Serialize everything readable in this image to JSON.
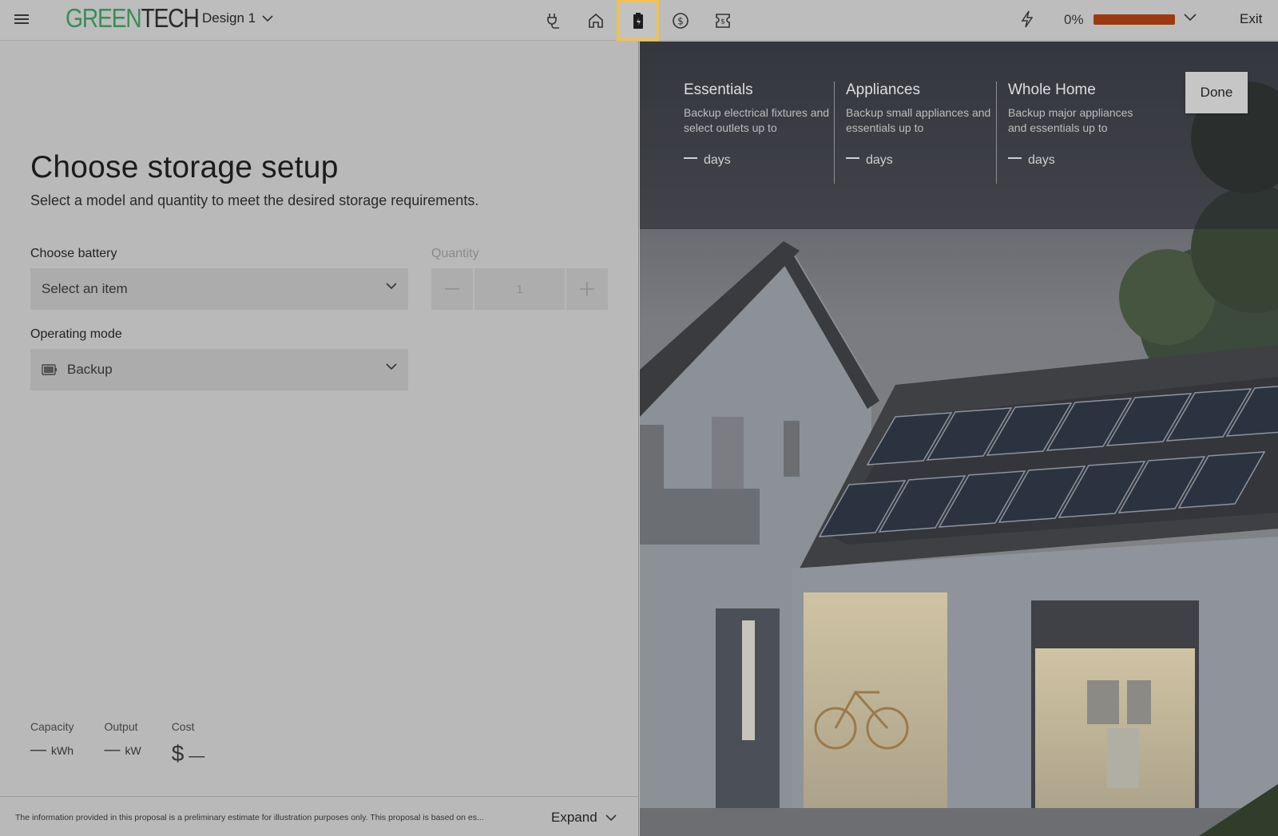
{
  "header": {
    "logo_green": "GREEN",
    "logo_dark": "TECH",
    "design_label": "Design 1",
    "nav_icons": [
      "plug-icon",
      "home-icon",
      "battery-icon",
      "dollar-icon",
      "proposal-icon"
    ],
    "active_nav": "battery-icon",
    "progress_label": "0%",
    "progress_value": 1.0,
    "exit_label": "Exit"
  },
  "main": {
    "title": "Choose storage setup",
    "subtitle": "Select a model and quantity to meet the desired storage requirements.",
    "battery_label": "Choose battery",
    "battery_placeholder": "Select an item",
    "quantity_label": "Quantity",
    "quantity_value": "1",
    "mode_label": "Operating mode",
    "mode_value": "Backup"
  },
  "stats": {
    "capacity_label": "Capacity",
    "capacity_value": "—",
    "capacity_unit": "kWh",
    "output_label": "Output",
    "output_value": "—",
    "output_unit": "kW",
    "cost_label": "Cost",
    "cost_currency": "$",
    "cost_value": "—"
  },
  "footer": {
    "disclaimer": "The information provided in this proposal is a preliminary estimate for illustration purposes only. This proposal is based on es...",
    "expand_label": "Expand"
  },
  "backup": {
    "cards": [
      {
        "title": "Essentials",
        "desc": "Backup electrical fixtures and select outlets up to",
        "unit": "days"
      },
      {
        "title": "Appliances",
        "desc": "Backup small appliances and essentials up to",
        "unit": "days"
      },
      {
        "title": "Whole Home",
        "desc": "Backup major appliances and essentials up to",
        "unit": "days"
      }
    ],
    "done_label": "Done"
  },
  "colors": {
    "brand_green": "#3a8d59",
    "progress_fill": "#9b3a12",
    "active_outline": "#f2c14e"
  }
}
